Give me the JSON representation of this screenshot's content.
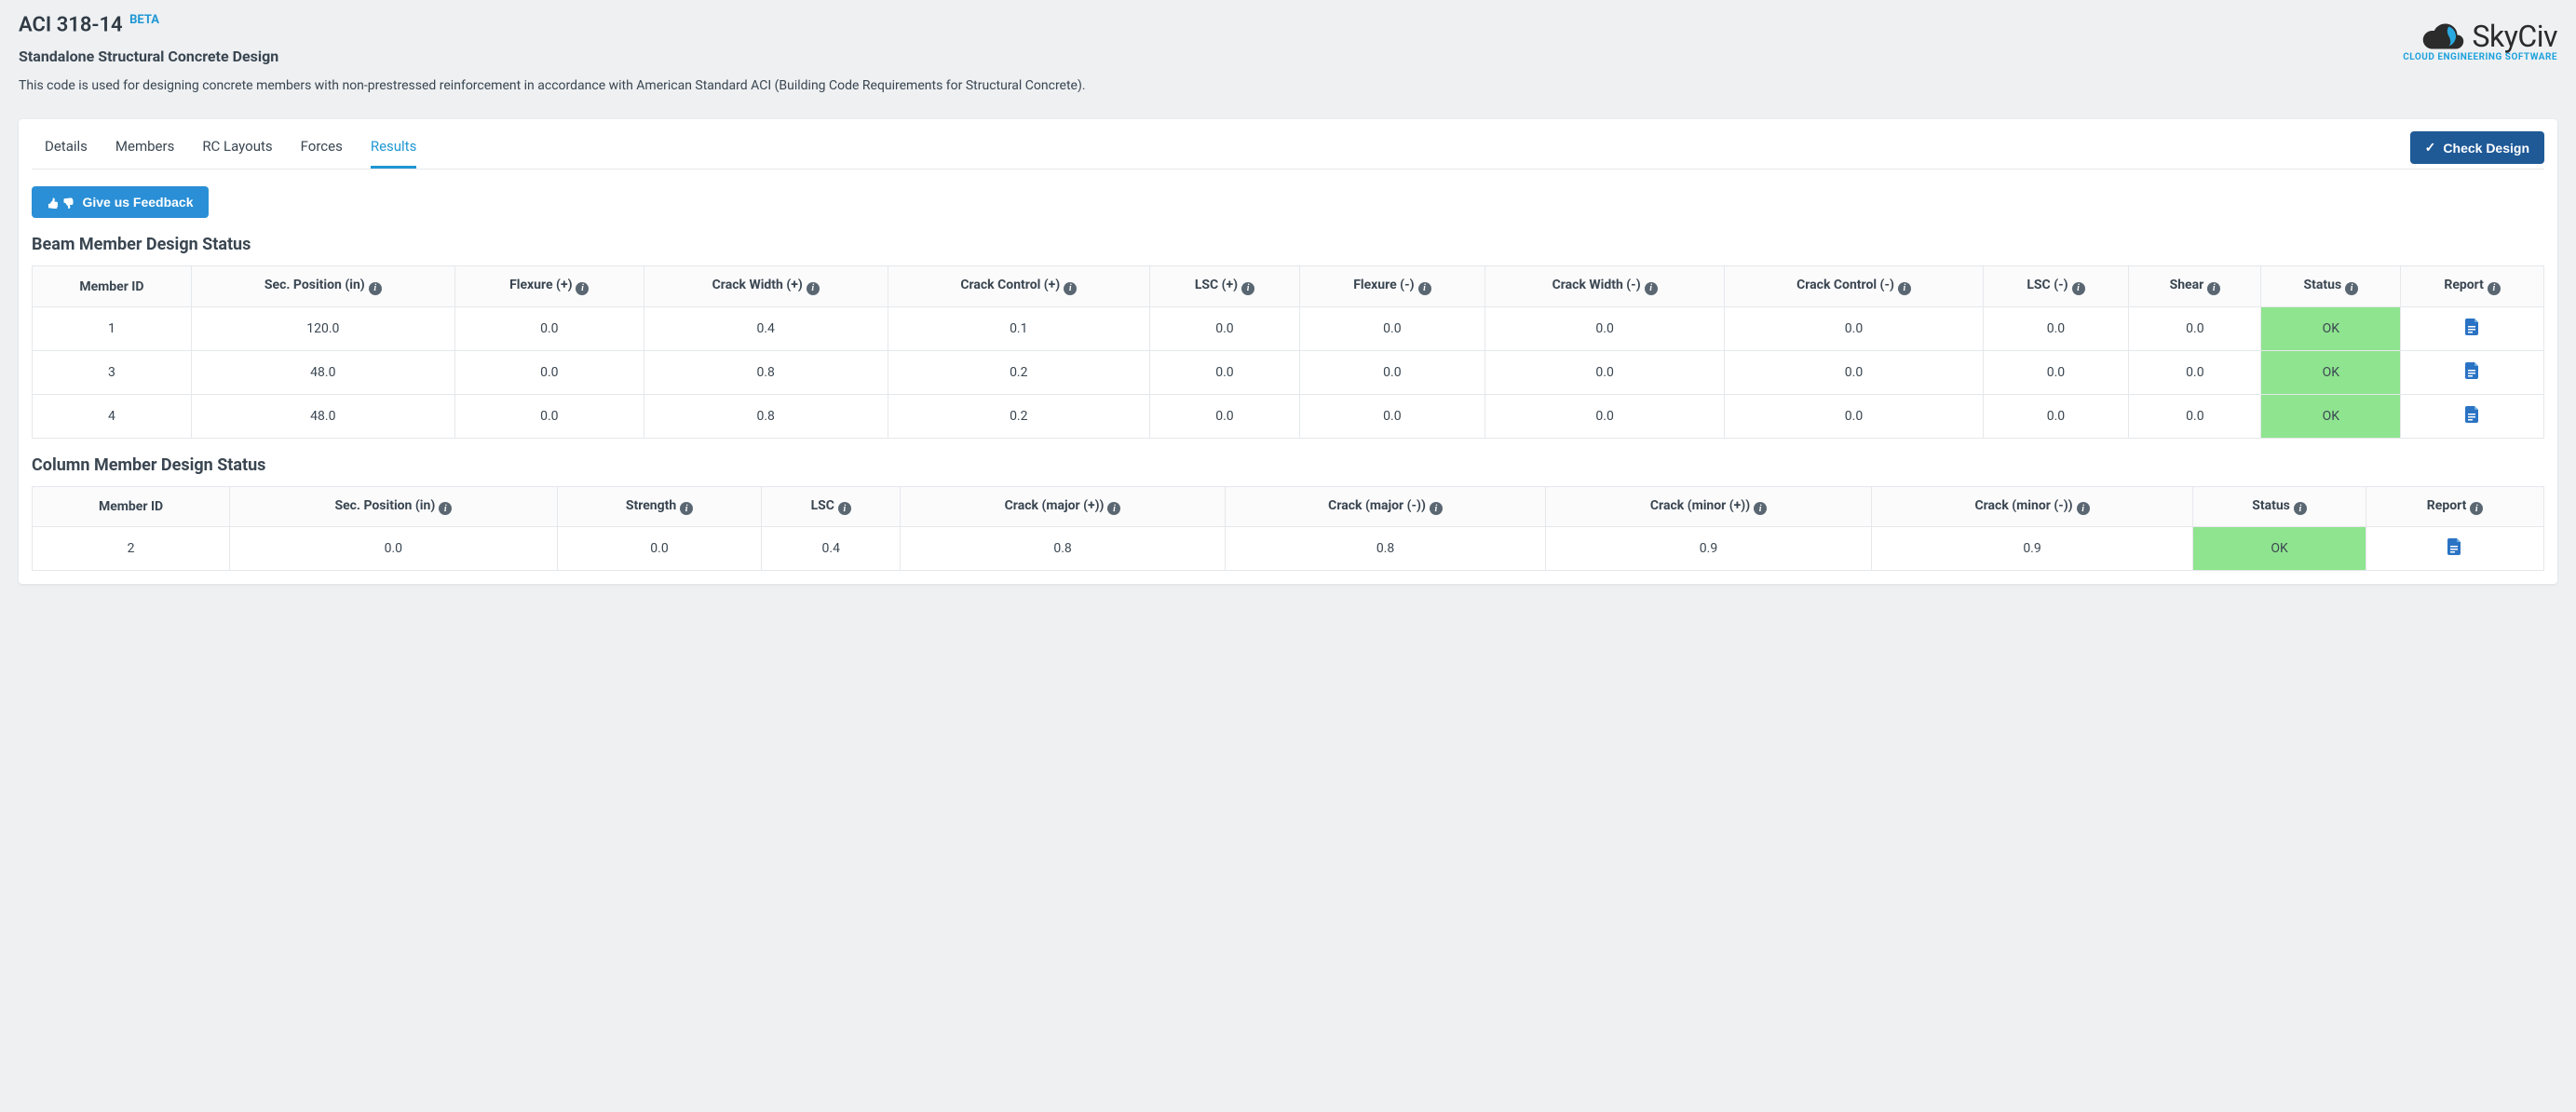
{
  "header": {
    "title": "ACI 318-14",
    "beta": "BETA",
    "subtitle": "Standalone Structural Concrete Design",
    "description": "This code is used for designing concrete members with non-prestressed reinforcement in accordance with American Standard ACI (Building Code Requirements for Structural Concrete)."
  },
  "logo": {
    "name": "SkyCiv",
    "tagline": "CLOUD ENGINEERING SOFTWARE"
  },
  "tabs": {
    "items": [
      "Details",
      "Members",
      "RC Layouts",
      "Forces",
      "Results"
    ],
    "active": 4
  },
  "buttons": {
    "check_design": "Check Design",
    "feedback": "Give us Feedback"
  },
  "beam": {
    "title": "Beam Member Design Status",
    "headers": [
      "Member ID",
      "Sec. Position (in)",
      "Flexure (+)",
      "Crack Width (+)",
      "Crack Control (+)",
      "LSC (+)",
      "Flexure (-)",
      "Crack Width (-)",
      "Crack Control (-)",
      "LSC (-)",
      "Shear",
      "Status",
      "Report"
    ],
    "info_cols": [
      false,
      true,
      true,
      true,
      true,
      true,
      true,
      true,
      true,
      true,
      true,
      true,
      true
    ],
    "rows": [
      {
        "id": "1",
        "pos": "120.0",
        "flex_p": "0.0",
        "cw_p": "0.4",
        "cc_p": "0.1",
        "lsc_p": "0.0",
        "flex_n": "0.0",
        "cw_n": "0.0",
        "cc_n": "0.0",
        "lsc_n": "0.0",
        "shear": "0.0",
        "status": "OK"
      },
      {
        "id": "3",
        "pos": "48.0",
        "flex_p": "0.0",
        "cw_p": "0.8",
        "cc_p": "0.2",
        "lsc_p": "0.0",
        "flex_n": "0.0",
        "cw_n": "0.0",
        "cc_n": "0.0",
        "lsc_n": "0.0",
        "shear": "0.0",
        "status": "OK"
      },
      {
        "id": "4",
        "pos": "48.0",
        "flex_p": "0.0",
        "cw_p": "0.8",
        "cc_p": "0.2",
        "lsc_p": "0.0",
        "flex_n": "0.0",
        "cw_n": "0.0",
        "cc_n": "0.0",
        "lsc_n": "0.0",
        "shear": "0.0",
        "status": "OK"
      }
    ]
  },
  "column": {
    "title": "Column Member Design Status",
    "headers": [
      "Member ID",
      "Sec. Position (in)",
      "Strength",
      "LSC",
      "Crack (major (+))",
      "Crack (major (-))",
      "Crack (minor (+))",
      "Crack (minor (-))",
      "Status",
      "Report"
    ],
    "info_cols": [
      false,
      true,
      true,
      true,
      true,
      true,
      true,
      true,
      true,
      true
    ],
    "rows": [
      {
        "id": "2",
        "pos": "0.0",
        "strength": "0.0",
        "lsc": "0.4",
        "cmajp": "0.8",
        "cmajn": "0.8",
        "cminp": "0.9",
        "cminn": "0.9",
        "status": "OK"
      }
    ]
  }
}
